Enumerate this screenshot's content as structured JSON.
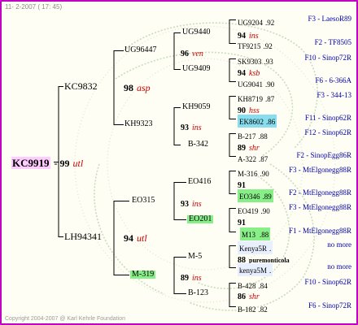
{
  "header": "11- 2-2007 ( 17: 45)",
  "footer": "Copyright 2004-2007 @ Karl Kehrle Foundation",
  "root": {
    "id": "KC9919",
    "gen": "99",
    "sub": "utl"
  },
  "sire": {
    "id": "KC9832",
    "gen": "98",
    "sub": "asp"
  },
  "dam": {
    "id": "LH94341",
    "gen": "94",
    "sub": "utl"
  },
  "sire_sire": {
    "id": "UG96447",
    "gen": "96",
    "sub": "ven"
  },
  "sire_dam": {
    "id": "KH9323",
    "gen": "93",
    "sub": "ins"
  },
  "dam_sire": {
    "id": "EO315",
    "gen": "93",
    "sub": "ins"
  },
  "dam_dam": {
    "id": "M-319",
    "gen": "89",
    "sub": "ins"
  },
  "gen3": [
    {
      "id": "UG9440"
    },
    {
      "id": "UG9409"
    },
    {
      "id": "KH9059",
      "gen": "90",
      "sub": "hss"
    },
    {
      "id": "B-342",
      "gen": "89",
      "sub": "shr"
    },
    {
      "id": "EO416",
      "gen": "91"
    },
    {
      "id": "EO201",
      "gen": "91"
    },
    {
      "id": "M-5",
      "gen": "88",
      "sub": "puremonticola"
    },
    {
      "id": "B-123",
      "gen": "86",
      "sub": "shr"
    }
  ],
  "gen3_mid": {
    "gen": "94",
    "sub": "ins"
  },
  "gen3_mid2": {
    "gen": "94",
    "sub": "ksb"
  },
  "gen4": [
    {
      "id": "UG9204",
      "val": ".92",
      "pop": "F3 - LaesoR89"
    },
    {
      "id": "TF9215",
      "val": ".92",
      "pop": "F2 - TF8505"
    },
    {
      "id": "SK9303",
      "val": ".93",
      "pop": "F10 - Sinop72R"
    },
    {
      "id": "UG9041",
      "val": ".90",
      "pop": "F6 - 6-366A"
    },
    {
      "id": "KH8719",
      "val": ".87",
      "pop": "F3 - 344-13"
    },
    {
      "id": "EK8602",
      "val": ".86",
      "pop": "F11 - Sinop62R"
    },
    {
      "id": "B-217",
      "val": ".88",
      "pop": "F12 - Sinop62R"
    },
    {
      "id": "A-322",
      "val": ".87",
      "pop": "F2 - SinopEgg86R"
    },
    {
      "id": "M-316",
      "val": ".90",
      "pop": "F3 - MtElgonegg88R"
    },
    {
      "id": "EO346",
      "val": ".89",
      "pop": "F2 - MtElgonegg88R"
    },
    {
      "id": "EO419",
      "val": ".90",
      "pop": "F3 - MtElgonegg88R"
    },
    {
      "id": "M13",
      "val": ".88",
      "pop": "F1 - MtElgonegg88R"
    },
    {
      "id": "Kenya5R",
      "val": ".",
      "pop": "no more"
    },
    {
      "id": "kenya5M",
      "val": ".",
      "pop": "no more"
    },
    {
      "id": "B-428",
      "val": ".84",
      "pop": "F10 - Sinop62R"
    },
    {
      "id": "B-182",
      "val": ".82",
      "pop": "F6 - Sinop72R"
    }
  ]
}
